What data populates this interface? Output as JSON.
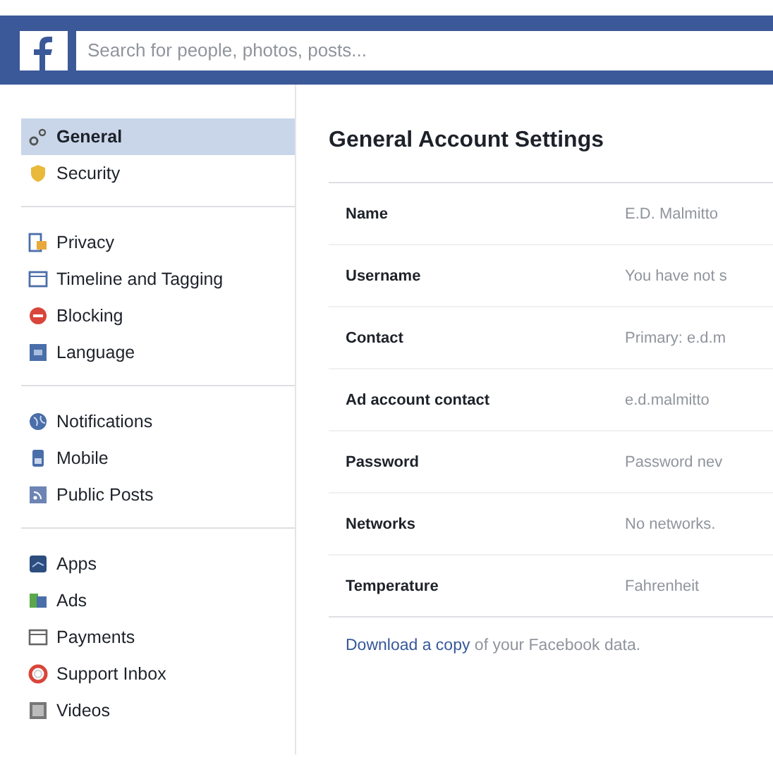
{
  "header": {
    "search": {
      "placeholder": "Search for people, photos, posts..."
    }
  },
  "sidebar": {
    "groups": [
      {
        "items": [
          {
            "label": "General",
            "selected": true
          },
          {
            "label": "Security",
            "selected": false
          }
        ]
      },
      {
        "items": [
          {
            "label": "Privacy",
            "selected": false
          },
          {
            "label": "Timeline and Tagging",
            "selected": false
          },
          {
            "label": "Blocking",
            "selected": false
          },
          {
            "label": "Language",
            "selected": false
          }
        ]
      },
      {
        "items": [
          {
            "label": "Notifications",
            "selected": false
          },
          {
            "label": "Mobile",
            "selected": false
          },
          {
            "label": "Public Posts",
            "selected": false
          }
        ]
      },
      {
        "items": [
          {
            "label": "Apps",
            "selected": false
          },
          {
            "label": "Ads",
            "selected": false
          },
          {
            "label": "Payments",
            "selected": false
          },
          {
            "label": "Support Inbox",
            "selected": false
          },
          {
            "label": "Videos",
            "selected": false
          }
        ]
      }
    ]
  },
  "main": {
    "title": "General Account Settings",
    "rows": [
      {
        "label": "Name",
        "value": "E.D. Malmitto"
      },
      {
        "label": "Username",
        "value": "You have not s"
      },
      {
        "label": "Contact",
        "value": "Primary: e.d.m"
      },
      {
        "label": "Ad account contact",
        "value": "e.d.malmitto"
      },
      {
        "label": "Password",
        "value": "Password nev"
      },
      {
        "label": "Networks",
        "value": "No networks."
      },
      {
        "label": "Temperature",
        "value": "Fahrenheit"
      }
    ],
    "footer": {
      "link": "Download a copy",
      "text": " of your Facebook data."
    }
  }
}
